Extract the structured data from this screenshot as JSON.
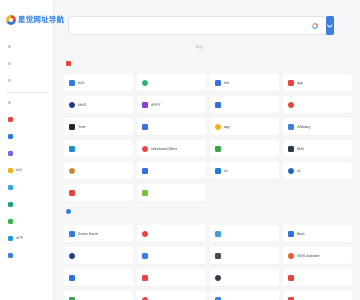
{
  "brand": {
    "name": "星觉网址导航"
  },
  "sidebar": {
    "top_items": [
      {
        "label": ""
      },
      {
        "label": ""
      },
      {
        "label": ""
      }
    ],
    "items": [
      {
        "label": "",
        "icon": "fire-icon",
        "color": "#e8453c"
      },
      {
        "label": "",
        "icon": "shield-icon",
        "color": "#2f7de1"
      },
      {
        "label": "",
        "icon": "grid-icon",
        "color": "#7b61e4"
      },
      {
        "label": "AIG",
        "icon": "ai-icon",
        "color": "#f2b01e"
      },
      {
        "label": "",
        "icon": "drop-icon",
        "color": "#2fa8e1"
      },
      {
        "label": "",
        "icon": "globe-icon",
        "color": "#1fa37a"
      },
      {
        "label": "",
        "icon": "book-icon",
        "color": "#38b24a"
      },
      {
        "label": "APP",
        "icon": "app-icon",
        "color": "#1aa0d8"
      },
      {
        "label": "",
        "icon": "qr-icon",
        "color": "#3b7fe0"
      }
    ]
  },
  "search": {
    "placeholder": "",
    "notice": "本站 ..."
  },
  "sections": [
    {
      "title": "",
      "icon": "fire-icon",
      "color": "#e8453c",
      "cards": [
        {
          "label": "AIG",
          "color": "#2f7de1"
        },
        {
          "label": "",
          "color": "#2fb36e"
        },
        {
          "label": "Ilm",
          "color": "#3a6fe0"
        },
        {
          "label": "app",
          "color": "#e8453c"
        },
        {
          "label": "MAS",
          "color": "#1e3c8c"
        },
        {
          "label": "APPT",
          "color": "#8b3fd9"
        },
        {
          "label": "",
          "color": "#2f6fe0"
        },
        {
          "label": "",
          "color": "#e8453c"
        },
        {
          "label": "Tree",
          "color": "#1f2a2a"
        },
        {
          "label": "",
          "color": "#3a6fe0"
        },
        {
          "label": "app",
          "color": "#f2b01e"
        },
        {
          "label": "ZBbrary",
          "color": "#3b7fe0"
        },
        {
          "label": "",
          "color": "#1c8ecf"
        },
        {
          "label": "Windows/Office",
          "color": "#e8453c"
        },
        {
          "label": "",
          "color": "#3aa84a"
        },
        {
          "label": "IBM",
          "color": "#2f3a4a"
        },
        {
          "label": "",
          "color": "#c8863a"
        },
        {
          "label": "",
          "color": "#2f6fe0"
        },
        {
          "label": "AI",
          "color": "#1e7bd8"
        },
        {
          "label": "AI",
          "color": "#2060c0"
        },
        {
          "label": "",
          "color": "#e8453c"
        },
        {
          "label": "",
          "color": "#7ac143"
        }
      ]
    },
    {
      "title": "",
      "icon": "shield-icon",
      "color": "#2f7de1",
      "cards": [
        {
          "label": "Zoom Earth",
          "color": "#2f7de1"
        },
        {
          "label": "",
          "color": "#e8453c"
        },
        {
          "label": "",
          "color": "#3aa0d8"
        },
        {
          "label": "Blob",
          "color": "#2f6fe0"
        },
        {
          "label": "",
          "color": "#1e3c8c"
        },
        {
          "label": "",
          "color": "#3b7fe0"
        },
        {
          "label": "",
          "color": "#4a4a4a"
        },
        {
          "label": "SMS Activate",
          "color": "#e85a2c"
        },
        {
          "label": "",
          "color": "#2f6fe0"
        },
        {
          "label": "",
          "color": "#e8453c"
        },
        {
          "label": "",
          "color": "#2f3a4a"
        },
        {
          "label": "",
          "color": "#e8453c"
        },
        {
          "label": "",
          "color": "#3aa84a"
        },
        {
          "label": "",
          "color": "#e8453c"
        },
        {
          "label": "",
          "color": "#3b7fe0"
        },
        {
          "label": "",
          "color": "#e8453c"
        }
      ]
    }
  ]
}
